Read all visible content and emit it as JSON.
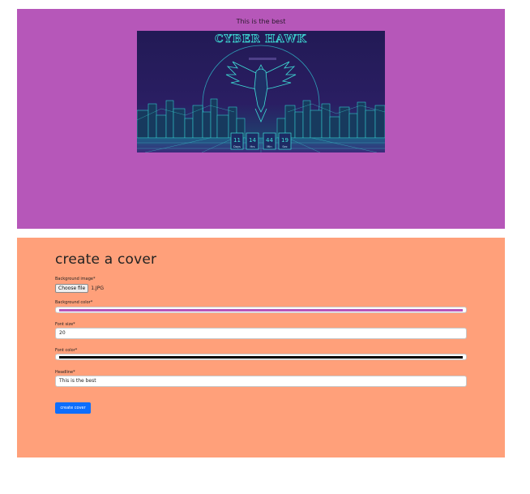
{
  "preview": {
    "headline": "This is the best",
    "background_color": "#b657b9",
    "image": {
      "title": "CYBER HAWK",
      "countdown": [
        {
          "value": "11",
          "unit": "Days"
        },
        {
          "value": "14",
          "unit": "Hrs"
        },
        {
          "value": "44",
          "unit": "Min"
        },
        {
          "value": "19",
          "unit": "Sec"
        }
      ]
    }
  },
  "form": {
    "title": "create a cover",
    "background_image_label": "Background image*",
    "file_button_label": "Choose file",
    "file_name": "1.JPG",
    "background_color_label": "Background color*",
    "background_color_value": "#b657b9",
    "font_size_label": "Font size*",
    "font_size_value": "20",
    "font_color_label": "Font color*",
    "font_color_value": "#000000",
    "headline_label": "Headline*",
    "headline_value": "This is the best",
    "submit_label": "create cover",
    "panel_color": "#ffa07a",
    "button_color": "#0d6efd"
  }
}
